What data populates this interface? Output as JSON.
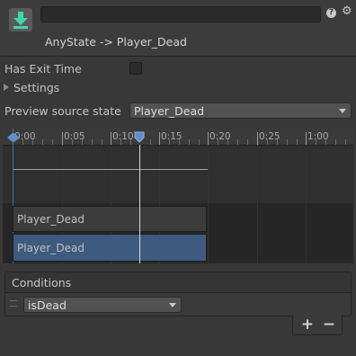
{
  "header": {
    "title": "AnyState -> Player_Dead",
    "name_value": "",
    "icons": [
      "transition-icon",
      "help-icon",
      "gear-icon"
    ]
  },
  "settings": {
    "has_exit_time_label": "Has Exit Time",
    "has_exit_time_checked": false,
    "settings_label": "Settings",
    "settings_expanded": false,
    "preview_label": "Preview source state",
    "preview_value": "Player_Dead"
  },
  "timeline": {
    "ticks": [
      "0:00",
      "0:05",
      "0:10",
      "0:15",
      "0:20",
      "0:25",
      "1:00"
    ],
    "source_state": "Player_Dead",
    "destination_state": "Player_Dead"
  },
  "conditions": {
    "title": "Conditions",
    "items": [
      {
        "parameter": "isDead"
      }
    ],
    "add_label": "+",
    "remove_label": "−"
  },
  "colors": {
    "accent": "#3d6ea3",
    "destination_bar": "#3e5a7e",
    "background": "#383838"
  }
}
